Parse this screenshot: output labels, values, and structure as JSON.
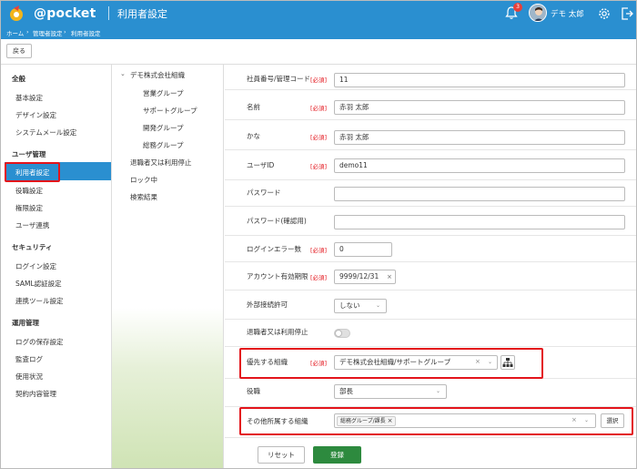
{
  "header": {
    "logo": "@pocket",
    "title": "利用者設定",
    "notification_count": "3",
    "user_name": "デモ 太郎"
  },
  "breadcrumb": [
    "ホーム",
    "›",
    "管理者設定",
    "›",
    "利用者設定"
  ],
  "toolbar": {
    "back_label": "戻る"
  },
  "sidebar": {
    "sections": [
      {
        "title": "全般",
        "items": [
          "基本設定",
          "デザイン設定",
          "システムメール設定"
        ]
      },
      {
        "title": "ユーザ管理",
        "items": [
          "利用者設定",
          "役職設定",
          "権限設定",
          "ユーザ連携"
        ]
      },
      {
        "title": "セキュリティ",
        "items": [
          "ログイン設定",
          "SAML認証設定",
          "連携ツール設定"
        ]
      },
      {
        "title": "運用管理",
        "items": [
          "ログの保存設定",
          "監査ログ",
          "使用状況",
          "契約内容管理"
        ]
      }
    ],
    "active": "利用者設定"
  },
  "tree": {
    "root": "デモ株式会社組織",
    "children": [
      "営業グループ",
      "サポートグループ",
      "開発グループ",
      "総務グループ"
    ],
    "others": [
      "退職者又は利用停止",
      "ロック中",
      "検索結果"
    ]
  },
  "form": {
    "required_label": "[必須]",
    "employee_no": {
      "label": "社員番号/管理コード",
      "value": "11"
    },
    "name": {
      "label": "名前",
      "value": "赤羽 太郎"
    },
    "kana": {
      "label": "かな",
      "value": "赤羽 太郎"
    },
    "user_id": {
      "label": "ユーザID",
      "value": "demo11"
    },
    "password": {
      "label": "パスワード",
      "value": ""
    },
    "password_confirm": {
      "label": "パスワード(確認用)",
      "value": ""
    },
    "login_errors": {
      "label": "ログインエラー数",
      "value": "0"
    },
    "expiry": {
      "label": "アカウント有効期限",
      "value": "9999/12/31"
    },
    "external_access": {
      "label": "外部接続許可",
      "value": "しない"
    },
    "retired": {
      "label": "退職者又は利用停止"
    },
    "primary_org": {
      "label": "優先する組織",
      "value": "デモ株式会社組織/サポートグループ"
    },
    "position": {
      "label": "役職",
      "value": "部長"
    },
    "other_orgs": {
      "label": "その他所属する組織",
      "tag": "総務グループ/課長",
      "select_label": "選択"
    },
    "reset_label": "リセット",
    "save_label": "登録"
  },
  "colors": {
    "header": "#2a8fd0",
    "save": "#2d8a3e",
    "highlight": "#e3141b"
  }
}
